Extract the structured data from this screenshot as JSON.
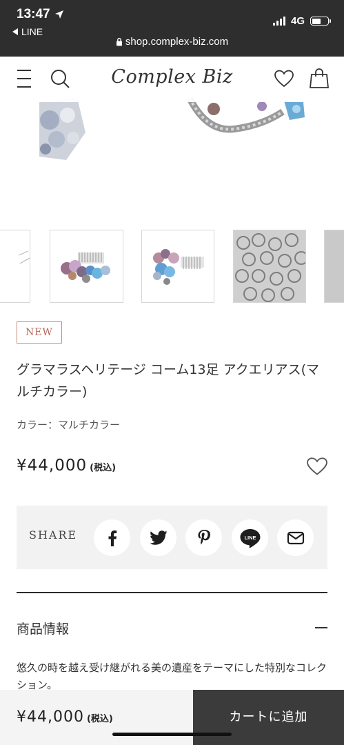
{
  "status": {
    "time": "13:47",
    "back_app": "LINE",
    "network": "4G",
    "url": "shop.complex-biz.com"
  },
  "header": {
    "logo": "Complex Biz"
  },
  "gallery": {
    "thumbnail_count": 4
  },
  "product": {
    "badge": "NEW",
    "title": "グラマラスヘリテージ コーム13足 アクエリアス(マルチカラー)",
    "color_label": "カラー：マルチカラー",
    "price": "¥44,000",
    "tax_label": "(税込)"
  },
  "share": {
    "label": "SHARE",
    "buttons": [
      {
        "icon": "facebook-icon"
      },
      {
        "icon": "twitter-icon"
      },
      {
        "icon": "pinterest-icon"
      },
      {
        "icon": "line-icon",
        "text": "LINE"
      },
      {
        "icon": "mail-icon"
      }
    ]
  },
  "info": {
    "heading": "商品情報",
    "description": "悠久の時を越え受け継がれる美の遺産をテーマにした特別なコレクション。"
  },
  "bottom_bar": {
    "price": "¥44,000",
    "tax_label": "(税込)",
    "cart_button": "カートに追加"
  },
  "colors": {
    "status_bar": "#2e2e2e",
    "badge": "#b5685a",
    "share_bg": "#f2f2f2",
    "cart_button": "#3b3b3b"
  }
}
